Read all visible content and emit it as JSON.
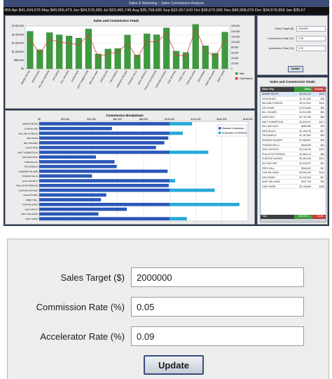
{
  "app": {
    "title": "Sales & Marketing :: Sales Commission Analysis"
  },
  "ticker": "456   Apr $41,434,676   May $40,956,473   Jun $34,576,955   Jul $33,465,746   Aug $35,758,695   Sep $32,957,643   Oct $38,670,695   Nov $40,958,675   Dec $34,576,959   Jan $35,67",
  "colors": {
    "bar_green": "#3e9a3e",
    "commission_red": "#d23c3c",
    "std_commission": "#2a57b8",
    "accel_commission": "#27a9d9",
    "table_header": "#3d3d3d",
    "table_total": "#3c9c3c"
  },
  "bar_panel": {
    "title": "Sales and Commission Totals",
    "legend": [
      "Sale",
      "Commission"
    ]
  },
  "hbar_panel": {
    "title": "Commission Breakdown",
    "legend": [
      "Standard Commission",
      "Accelerated Commission"
    ]
  },
  "rates_panel": {
    "fields": [
      {
        "label": "Sales Target ($):",
        "value": "2000000"
      },
      {
        "label": "Commission Rate (%):",
        "value": "0.05"
      },
      {
        "label": "Accelerator Rate (%):",
        "value": "0.09"
      }
    ],
    "update_label": "Update"
  },
  "table": {
    "title": "Sales and Commission Totals",
    "headers": [
      "Sales Rep",
      "Sales",
      "Commi..."
    ],
    "rows": [
      [
        "ANDRE REYES",
        "$2,191,112",
        "$109,"
      ],
      [
        "JOHN BLAKE",
        "$1,114,480",
        "$55,"
      ],
      [
        "WILLIAM GORDON",
        "$2,112,924",
        "$110,"
      ],
      [
        "JOE SHAW",
        "$1,978,836",
        "$98,"
      ],
      [
        "BILL HOLMES",
        "$1,918,289",
        "$95,"
      ],
      [
        "DAVID RICE",
        "$1,790,780",
        "$89,"
      ],
      [
        "MATT ROBERTSON",
        "$2,329,007",
        "$127,"
      ],
      [
        "WILLIAM HUNT",
        "$869,056",
        "$43,"
      ],
      [
        "MIKE BLACK",
        "$1,155,215",
        "$57,"
      ],
      [
        "TIM DANIELS",
        "$1,187,864",
        "$59,"
      ],
      [
        "ANDREW PALMER",
        "$1,968,857",
        "$98,"
      ],
      [
        "THOMAS MILLS",
        "$808,059",
        "$40,"
      ],
      [
        "JACK NICHOLS",
        "$2,046,515",
        "$103,"
      ],
      [
        "PHILLIP PATTERSON",
        "$1,986,113",
        "$99,"
      ],
      [
        "HUDSON HUGHES",
        "$2,383,446",
        "$132,"
      ],
      [
        "SUE MITCHEL",
        "$1,029,007",
        "$51,"
      ],
      [
        "FRED HALL",
        "$946,432",
        "$47,"
      ],
      [
        "TOM WILLIAMS",
        "$2,594,034",
        "$149,"
      ],
      [
        "DAN GRANT",
        "$1,342,254",
        "$67,"
      ],
      [
        "ANDY WILLIAMS",
        "$907,378",
        "$45,"
      ],
      [
        "GARY KERN",
        "$2,146,896",
        "$108,"
      ]
    ],
    "total": [
      "Total",
      "$35,987,1...",
      "$1,82..."
    ]
  },
  "form": {
    "sales_target_label": "Sales Target ($)",
    "sales_target_value": "2000000",
    "commission_rate_label": "Commission Rate (%)",
    "commission_rate_value": "0.05",
    "accelerator_rate_label": "Accelerator Rate (%)",
    "accelerator_rate_value": "0.09",
    "update_label": "Update"
  },
  "chart_data": [
    {
      "type": "bar",
      "title": "Sales and Commission Totals",
      "categories": [
        "ANDRE REYES",
        "JOHN BLAKE",
        "WILLIAM GORDON",
        "JOE SHAW",
        "BILL HOLMES",
        "DAVID RICE",
        "MATT ROBERTSON",
        "WILLIAM HUNT",
        "MIKE BLACK",
        "TIM DANIELS",
        "ANDREW PALMER",
        "THOMAS MILLS",
        "JACK NICHOLS",
        "PHILLIP PATTERSON",
        "HUDSON HUGHES",
        "SUE MITCHEL",
        "FRED HALL",
        "TOM WILLIAMS",
        "DAN GRANT",
        "ANDY WILLIAMS",
        "GARY KERN"
      ],
      "series": [
        {
          "name": "Sale",
          "values": [
            2191112,
            1114480,
            2112924,
            1978836,
            1918289,
            1790780,
            2329007,
            869056,
            1155215,
            1187864,
            1968857,
            808059,
            2046515,
            1986113,
            2383446,
            1029007,
            946432,
            2594034,
            1342254,
            907378,
            2146896
          ]
        },
        {
          "name": "Commission",
          "values": [
            109556,
            55724,
            110646,
            98942,
            95914,
            89539,
            127411,
            43453,
            57761,
            59393,
            98443,
            40403,
            103693,
            99306,
            132510,
            51450,
            47322,
            149463,
            67113,
            45369,
            108345
          ]
        }
      ],
      "y_left_ticks": [
        "$2,500,000",
        "$2,000,000",
        "$1,500,000",
        "$1,000,000",
        "$500,000",
        "$0"
      ],
      "y_right_ticks": [
        "160,000",
        "140,000",
        "120,000",
        "100,000",
        "80,000",
        "60,000",
        "40,000",
        "20,000",
        "0"
      ],
      "ylim": [
        0,
        2500000
      ],
      "y2lim": [
        0,
        160000
      ],
      "grid": true,
      "legend": "right"
    },
    {
      "type": "bar",
      "orientation": "horizontal",
      "title": "Commission Breakdown",
      "categories": [
        "ANDRE REYES",
        "JOHN BLAKE",
        "WILLIAM GORDON",
        "JOE SHAW",
        "BILL HOLMES",
        "DAVID RICE",
        "MATT ROBERTSON",
        "WILLIAM HUNT",
        "MIKE BLACK",
        "TIM DANIELS",
        "ANDREW PALMER",
        "THOMAS MILLS",
        "JACK NICHOLS",
        "PHILLIP PATTERSON",
        "HUDSON HUGHES",
        "SUE MITCHEL",
        "FRED HALL",
        "TOM WILLIAMS",
        "DAN GRANT",
        "ANDY WILLIAMS",
        "GARY KERN"
      ],
      "series": [
        {
          "name": "Standard Commission",
          "values": [
            100000,
            55724,
            100000,
            98942,
            95914,
            89539,
            100000,
            43453,
            57761,
            59393,
            98443,
            40403,
            100000,
            99306,
            100000,
            51450,
            47322,
            100000,
            67113,
            45369,
            100000
          ]
        },
        {
          "name": "Accelerated Commission",
          "values": [
            17200,
            0,
            10100,
            0,
            0,
            0,
            29600,
            0,
            0,
            0,
            0,
            0,
            4200,
            0,
            34500,
            0,
            0,
            53500,
            0,
            0,
            13200
          ]
        }
      ],
      "x_ticks": [
        "$0",
        "$20,000",
        "$40,000",
        "$60,000",
        "$80,000",
        "$100,000",
        "$120,000",
        "$140,000",
        "$160,000"
      ],
      "xlim": [
        0,
        160000
      ],
      "grid": true,
      "legend": "top-right"
    }
  ]
}
